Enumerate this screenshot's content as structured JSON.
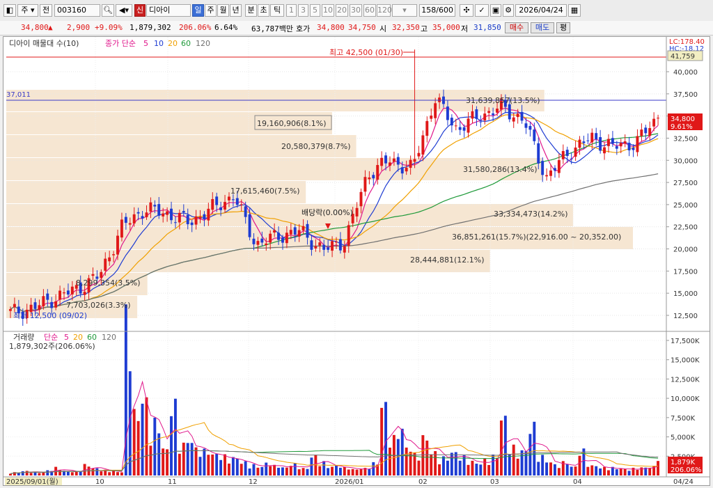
{
  "toolbar": {
    "mode": "주",
    "prev_label": "전",
    "code": "003160",
    "new_badge": "신",
    "stock_name": "디아이",
    "periods": [
      "일",
      "주",
      "월",
      "년",
      "분",
      "초",
      "틱"
    ],
    "active_period": "일",
    "intervals": [
      "1",
      "3",
      "5",
      "10",
      "20",
      "30",
      "60",
      "120"
    ],
    "count": "158",
    "count_max": "/600",
    "date": "2026/04/24"
  },
  "quote": {
    "price": "34,800",
    "change_arrow": "▲",
    "change": "2,900",
    "change_pct": "+9.09%",
    "volume": "1,879,302",
    "volume_ratio": "206.06%",
    "turnover": "6.64%",
    "amount": "63,787백만",
    "hoga_label": "호가",
    "ask": "34,800",
    "bid": "34,750",
    "open_label": "시",
    "open": "32,350",
    "high_label": "고",
    "high": "35,000",
    "low_label": "저",
    "low": "31,850",
    "buy_label": "매수",
    "sell_label": "매도",
    "eval_label": "평"
  },
  "price_legend": {
    "title": "디아이 매물대 수(10)",
    "ma_label": "종가 단순",
    "ma_periods": [
      "5",
      "10",
      "20",
      "60",
      "120"
    ],
    "ma_colors": [
      "#e0188c",
      "#1e3cd2",
      "#f0a000",
      "#1f9a3a",
      "#707070"
    ]
  },
  "volume_legend": {
    "title": "거래량",
    "ma_label": "단순",
    "ma_periods": [
      "5",
      "20",
      "60",
      "120"
    ],
    "value": "1,879,302주(206.06%)"
  },
  "price_axis": {
    "ticks": [
      "40,000",
      "37,500",
      "35,000",
      "32,500",
      "30,000",
      "27,500",
      "25,000",
      "22,500",
      "20,000",
      "17,500",
      "15,000",
      "12,500"
    ],
    "lc": "LC:178.40",
    "hc": "HC:-18.12",
    "top_box": "41,759",
    "last_price": "34,800",
    "last_pct": "9.61%"
  },
  "volume_axis": {
    "ticks": [
      "17,500K",
      "15,000K",
      "12,500K",
      "10,000K",
      "7,500K",
      "5,000K",
      "2,500K"
    ],
    "last_vol": "1,879K",
    "last_pct": "206.06%"
  },
  "x_axis": {
    "labels": [
      "2025/09/01(월)",
      "10",
      "11",
      "12",
      "2026/01",
      "02",
      "03",
      "04"
    ],
    "end_date": "04/24"
  },
  "annotations": {
    "high": "최고 42,500 (01/30)",
    "low": "최저 12,500 (09/02)",
    "dividend": "배당락(0.00%)",
    "hline_label": "37,011"
  },
  "profile_labels": [
    "19,160,906(8.1%)",
    "20,580,379(8.7%)",
    "31,580,286(13.4%)",
    "17,615,460(7.5%)",
    "33,334,473(14.2%)",
    "36,851,261(15.7%)(22,916.00 ~ 20,352.00)",
    "28,444,881(12.1%)",
    "8,299,354(3.5%)",
    "7,703,026(3.3%)",
    "31,639,857(13.5%)"
  ],
  "chart_data": [
    {
      "type": "candlestick",
      "title": "디아이 매물대 수(10)",
      "x": [
        "2025/09/01",
        "2025/10",
        "2025/11",
        "2025/12",
        "2026/01",
        "2026/02",
        "2026/03",
        "2026/04",
        "2026/04/24"
      ],
      "ylim": [
        11500,
        43500
      ],
      "y_ticks": [
        12500,
        15000,
        17500,
        20000,
        22500,
        25000,
        27500,
        30000,
        32500,
        35000,
        37500,
        40000
      ],
      "approx_close": [
        12800,
        13300,
        14500,
        15500,
        17000,
        22500,
        24500,
        24000,
        23000,
        24500,
        26000,
        20500,
        21500,
        22000,
        19800,
        21000,
        28500,
        30000,
        29000,
        37000,
        33500,
        35000,
        36000,
        34500,
        28000,
        31000,
        32500,
        31500,
        32000,
        34800
      ],
      "high": {
        "value": 42500,
        "date": "01/30"
      },
      "low": {
        "value": 12500,
        "date": "09/02"
      },
      "last": 34800,
      "horizontal_line": 37011,
      "volume_profile": [
        {
          "label": "36,851,261(15.7%)(22,916.00 ~ 20,352.00)",
          "volume": 36851261,
          "pct": 15.7,
          "range": [
            20352,
            22916
          ]
        },
        {
          "label": "33,334,473(14.2%)",
          "volume": 33334473,
          "pct": 14.2
        },
        {
          "label": "31,639,857(13.5%)",
          "volume": 31639857,
          "pct": 13.5
        },
        {
          "label": "31,580,286(13.4%)",
          "volume": 31580286,
          "pct": 13.4
        },
        {
          "label": "28,444,881(12.1%)",
          "volume": 28444881,
          "pct": 12.1
        },
        {
          "label": "20,580,379(8.7%)",
          "volume": 20580379,
          "pct": 8.7
        },
        {
          "label": "19,160,906(8.1%)",
          "volume": 19160906,
          "pct": 8.1
        },
        {
          "label": "17,615,460(7.5%)",
          "volume": 17615460,
          "pct": 7.5
        },
        {
          "label": "8,299,354(3.5%)",
          "volume": 8299354,
          "pct": 3.5
        },
        {
          "label": "7,703,026(3.3%)",
          "volume": 7703026,
          "pct": 3.3
        }
      ]
    },
    {
      "type": "bar",
      "title": "거래량",
      "ylim": [
        0,
        18500
      ],
      "y_unit": "K",
      "y_ticks": [
        2500,
        5000,
        7500,
        10000,
        12500,
        15000,
        17500
      ],
      "approx_values_k": [
        300,
        350,
        500,
        400,
        350,
        600,
        900,
        500,
        400,
        700,
        1200,
        800,
        600,
        500,
        400,
        18000,
        7000,
        8500,
        4500,
        6000,
        3000,
        8000,
        3500,
        4000,
        3000,
        2800,
        2400,
        2200,
        1800,
        2000,
        1500,
        1200,
        1000,
        1400,
        1100,
        900,
        1300,
        1000,
        800,
        2200,
        1500,
        1000,
        1100,
        900,
        700,
        800,
        1100,
        1400,
        8000,
        4200,
        5200,
        3200,
        2400,
        4300,
        2600,
        1800,
        2000,
        2600,
        2100,
        1600,
        1400,
        1800,
        2200,
        6500,
        3200,
        2400,
        2800,
        5600,
        2200,
        1600,
        1200,
        1500,
        1000,
        2800,
        1300,
        1100,
        900,
        900,
        800,
        700,
        800,
        900,
        1000,
        1879
      ],
      "last_k": 1879,
      "last_pct": 206.06
    }
  ]
}
